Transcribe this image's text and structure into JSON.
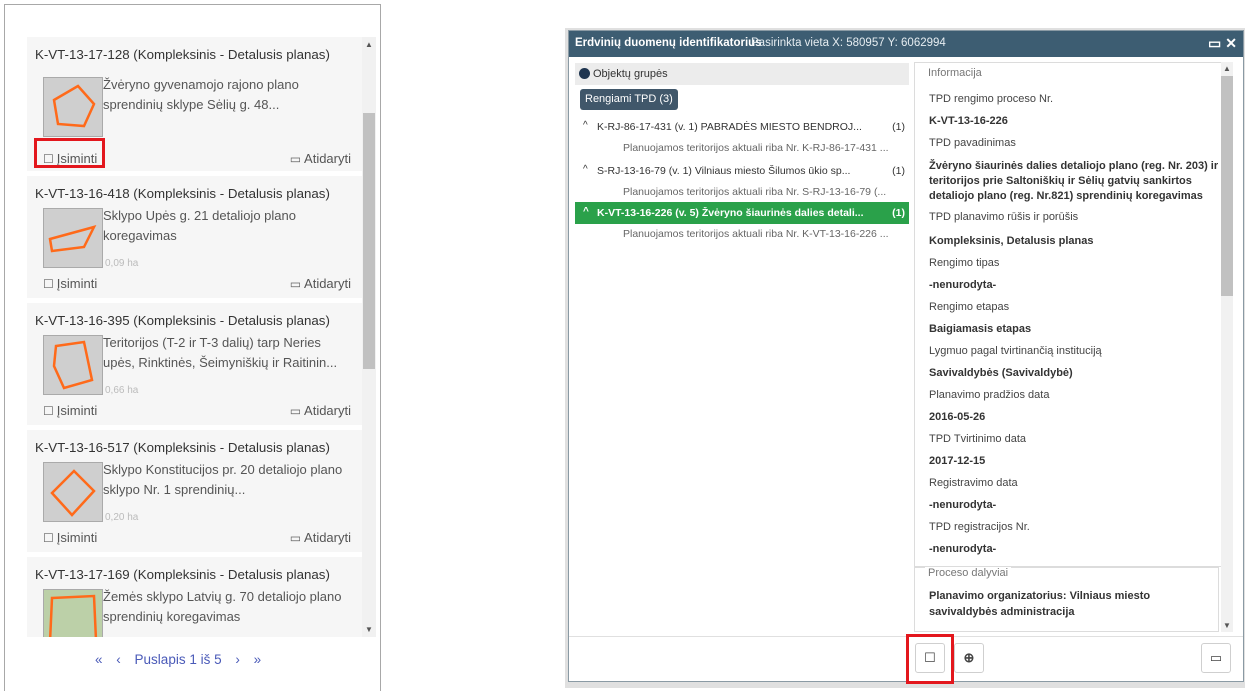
{
  "list": {
    "cards": [
      {
        "title": "K-VT-13-17-128 (Kompleksinis - Detalusis planas)",
        "desc": "Žvėryno gyvenamojo rajono plano sprendinių sklype Sėlių g. 48...",
        "area": "",
        "remember": "Įsiminti",
        "open": "Atidaryti"
      },
      {
        "title": "K-VT-13-16-418 (Kompleksinis - Detalusis planas)",
        "desc": "Sklypo Upės g. 21 detaliojo plano koregavimas",
        "area": "0,09 ha",
        "remember": "Įsiminti",
        "open": "Atidaryti"
      },
      {
        "title": "K-VT-13-16-395 (Kompleksinis - Detalusis planas)",
        "desc": "Teritorijos (T-2 ir T-3 dalių) tarp Neries upės, Rinktinės, Šeimyniškių ir Raitinin...",
        "area": "0,66 ha",
        "remember": "Įsiminti",
        "open": "Atidaryti"
      },
      {
        "title": "K-VT-13-16-517 (Kompleksinis - Detalusis planas)",
        "desc": "Sklypo Konstitucijos pr. 20 detaliojo plano sklypo Nr. 1 sprendinių...",
        "area": "0,20 ha",
        "remember": "Įsiminti",
        "open": "Atidaryti"
      },
      {
        "title": "K-VT-13-17-169 (Kompleksinis - Detalusis planas)",
        "desc": "Žemės sklypo Latvių g. 70 detaliojo plano sprendinių koregavimas",
        "area": "",
        "remember": "",
        "open": ""
      }
    ],
    "pager": {
      "label": "Puslapis 1 iš 5"
    }
  },
  "dialog": {
    "title": "Erdvinių duomenų identifikatorius",
    "location": "Pasirinkta vieta X: 580957 Y: 6062994",
    "group_label": "Objektų grupės",
    "tpd_badge": "Rengiami TPD (3)",
    "tree": [
      {
        "label": "K-RJ-86-17-431 (v. 1) PABRADĖS MIESTO BENDROJ...",
        "count": "(1)",
        "child": "Planuojamos teritorijos aktuali riba Nr. K-RJ-86-17-431 ...",
        "selected": false
      },
      {
        "label": "S-RJ-13-16-79 (v. 1) Vilniaus miesto Šilumos ūkio sp...",
        "count": "(1)",
        "child": "Planuojamos teritorijos aktuali riba Nr. S-RJ-13-16-79 (...",
        "selected": false
      },
      {
        "label": "K-VT-13-16-226 (v. 5) Žvėryno šiaurinės dalies detali...",
        "count": "(1)",
        "child": "Planuojamos teritorijos aktuali riba Nr. K-VT-13-16-226 ...",
        "selected": true
      }
    ],
    "info": {
      "legend": "Informacija",
      "fields": [
        {
          "label": "TPD rengimo proceso Nr.",
          "value": "K-VT-13-16-226"
        },
        {
          "label": "TPD pavadinimas",
          "value": "Žvėryno šiaurinės dalies detaliojo plano (reg. Nr. 203) ir teritorijos prie Saltoniškių ir Sėlių gatvių sankirtos detaliojo plano (reg. Nr.821) sprendinių koregavimas"
        },
        {
          "label": "TPD planavimo rūšis ir porūšis",
          "value": "Kompleksinis, Detalusis planas"
        },
        {
          "label": "Rengimo tipas",
          "value": "-nenurodyta-"
        },
        {
          "label": "Rengimo etapas",
          "value": "Baigiamasis etapas"
        },
        {
          "label": "Lygmuo pagal tvirtinančią instituciją",
          "value": "Savivaldybės (Savivaldybė)"
        },
        {
          "label": "Planavimo pradžios data",
          "value": "2016-05-26"
        },
        {
          "label": "TPD Tvirtinimo data",
          "value": "2017-12-15"
        },
        {
          "label": "Registravimo data",
          "value": "-nenurodyta-"
        },
        {
          "label": "TPD registracijos Nr.",
          "value": "-nenurodyta-"
        }
      ]
    },
    "process": {
      "legend": "Proceso dalyviai",
      "organizer": "Planavimo organizatorius: Vilniaus miesto savivaldybės administracija"
    }
  },
  "icons": {
    "bookmark": "bookmark-icon",
    "folder": "folder-open-icon",
    "zoom": "zoom-in-icon",
    "maximize": "maximize-icon",
    "close": "close-icon"
  },
  "colors": {
    "header": "#3d5d72",
    "selected": "#2aa14a",
    "highlight": "#e3171d",
    "link": "#4a5ab8"
  }
}
